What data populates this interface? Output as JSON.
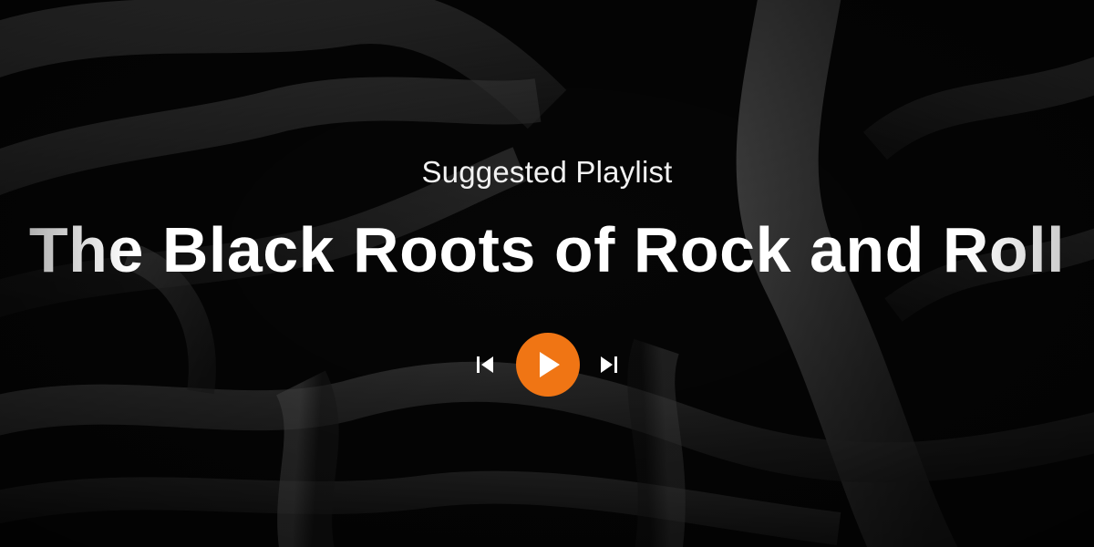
{
  "hero": {
    "eyebrow": "Suggested Playlist",
    "title": "The Black Roots of Rock and Roll"
  },
  "player": {
    "prev_icon": "skip-previous-icon",
    "play_icon": "play-icon",
    "next_icon": "skip-next-icon"
  },
  "colors": {
    "accent": "#f07514",
    "text": "#ffffff",
    "background": "#050505"
  }
}
